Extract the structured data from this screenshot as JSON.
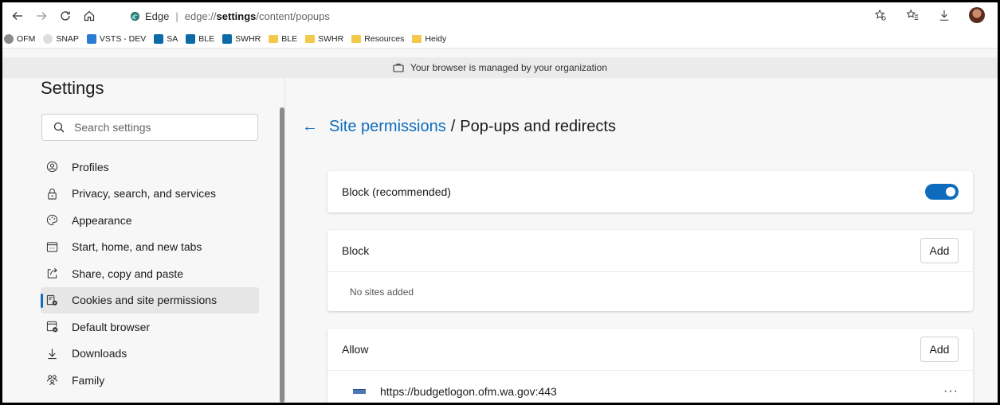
{
  "browser": {
    "brand": "Edge",
    "url_host": "edge://",
    "url_bold": "settings",
    "url_path": "/content/popups"
  },
  "favorites": [
    {
      "label": "OFM",
      "icon": "globe-icon"
    },
    {
      "label": "SNAP",
      "icon": "snap-icon"
    },
    {
      "label": "VSTS - DEV",
      "icon": "vsts-icon"
    },
    {
      "label": "SA",
      "icon": "sharepoint-icon"
    },
    {
      "label": "BLE",
      "icon": "sharepoint-icon"
    },
    {
      "label": "SWHR",
      "icon": "sharepoint-icon"
    },
    {
      "label": "BLE",
      "icon": "folder-icon"
    },
    {
      "label": "SWHR",
      "icon": "folder-icon"
    },
    {
      "label": "Resources",
      "icon": "folder-icon"
    },
    {
      "label": "Heidy",
      "icon": "folder-icon"
    }
  ],
  "managed_banner": "Your browser is managed by your organization",
  "sidebar": {
    "title": "Settings",
    "search_placeholder": "Search settings",
    "items": [
      {
        "label": "Profiles",
        "icon": "profile-icon"
      },
      {
        "label": "Privacy, search, and services",
        "icon": "lock-icon"
      },
      {
        "label": "Appearance",
        "icon": "palette-icon"
      },
      {
        "label": "Start, home, and new tabs",
        "icon": "newtab-icon"
      },
      {
        "label": "Share, copy and paste",
        "icon": "share-icon"
      },
      {
        "label": "Cookies and site permissions",
        "icon": "cookies-icon",
        "active": true
      },
      {
        "label": "Default browser",
        "icon": "default-browser-icon"
      },
      {
        "label": "Downloads",
        "icon": "download-icon"
      },
      {
        "label": "Family",
        "icon": "family-icon"
      }
    ]
  },
  "main": {
    "breadcrumb_link": "Site permissions",
    "breadcrumb_sep": "/",
    "breadcrumb_current": "Pop-ups and redirects",
    "block_recommended": {
      "label": "Block (recommended)",
      "enabled": true
    },
    "block": {
      "title": "Block",
      "add_label": "Add",
      "empty_text": "No sites added"
    },
    "allow": {
      "title": "Allow",
      "add_label": "Add",
      "sites": [
        "https://budgetlogon.ofm.wa.gov:443"
      ]
    },
    "more_label": "···"
  },
  "colors": {
    "accent": "#0f6cbd"
  }
}
